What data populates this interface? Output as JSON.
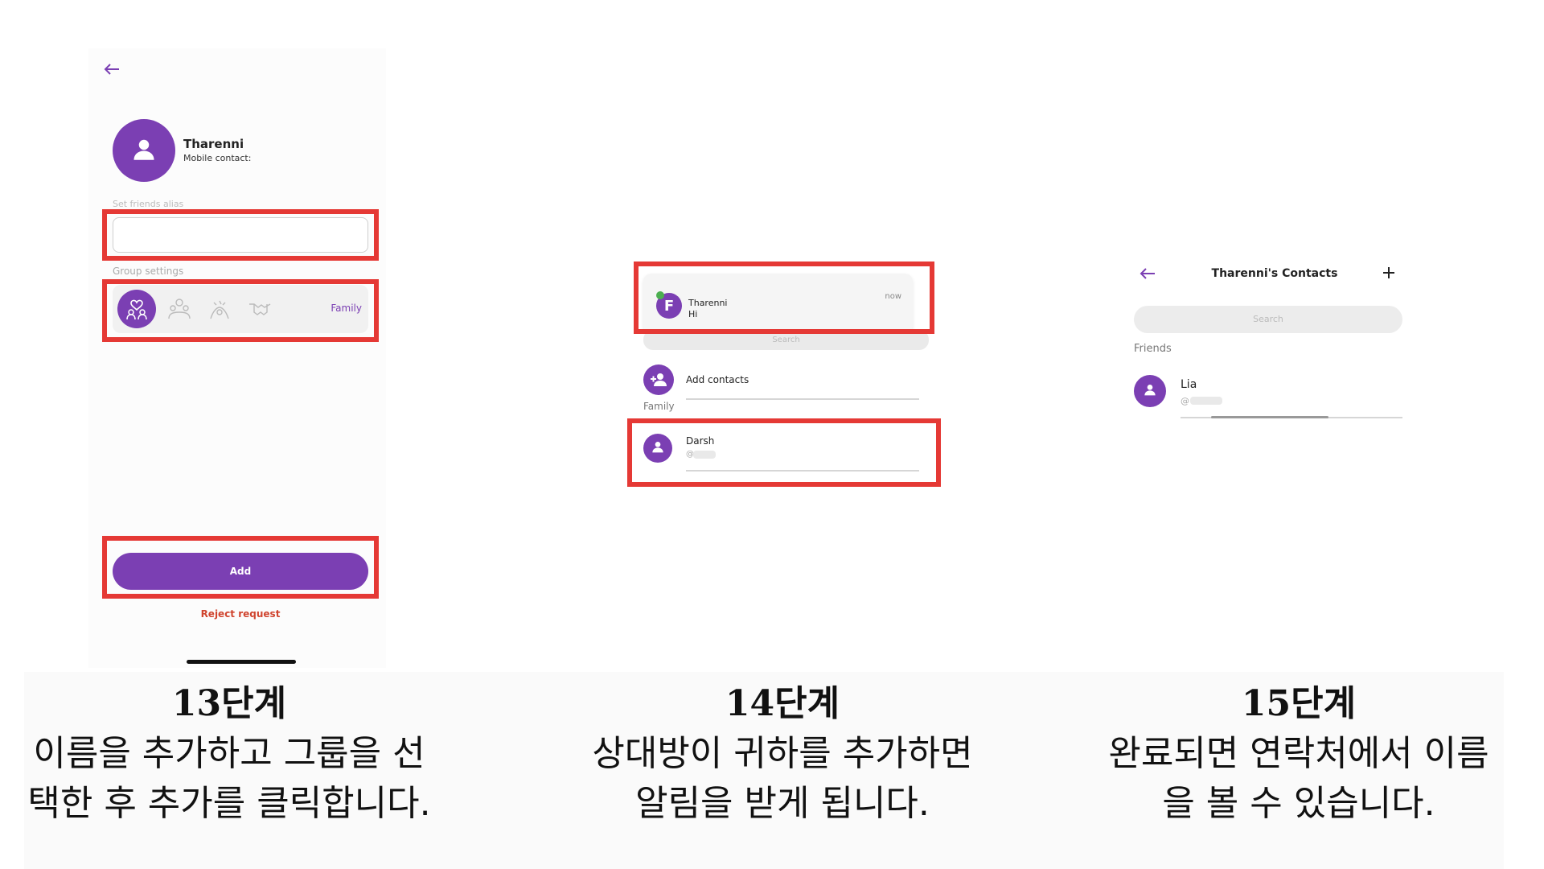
{
  "panel1": {
    "contact_name": "Tharenni",
    "contact_subtitle": "Mobile contact:",
    "alias_label": "Set friends alias",
    "alias_value": "",
    "group_label": "Group settings",
    "group_selected": "Family",
    "add_button": "Add",
    "reject_link": "Reject request",
    "icons": [
      "back-arrow-icon",
      "person-icon",
      "family-group-icon",
      "friends-group-icon",
      "love-icon",
      "handshake-icon"
    ]
  },
  "panel2": {
    "notification": {
      "sender": "Tharenni",
      "message": "Hi",
      "time": "now"
    },
    "search_placeholder": "Search",
    "add_contacts": "Add contacts",
    "group_header": "Family",
    "contact_name": "Darsh",
    "contact_handle": "@"
  },
  "panel3": {
    "title": "Tharenni's  Contacts",
    "search_placeholder": "Search",
    "section": "Friends",
    "contact_name": "Lia",
    "contact_handle": "@"
  },
  "captions": [
    {
      "step": "13단계",
      "line1": "이름을 추가하고 그룹을 선",
      "line2": "택한 후 추가를 클릭합니다."
    },
    {
      "step": "14단계",
      "line1": "상대방이 귀하를 추가하면",
      "line2": "알림을 받게 됩니다."
    },
    {
      "step": "15단계",
      "line1": "완료되면 연락처에서 이름",
      "line2": "을 볼 수 있습니다."
    }
  ],
  "colors": {
    "accent": "#7b3fb3",
    "highlight": "#e53935",
    "reject": "#d0452f"
  }
}
